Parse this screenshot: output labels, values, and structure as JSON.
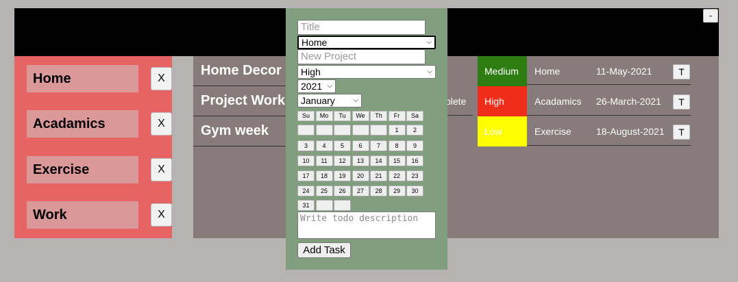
{
  "header": {
    "minimize_label": "-"
  },
  "sidebar": {
    "categories": [
      {
        "label": "Home",
        "remove_label": "X"
      },
      {
        "label": "Acadamics",
        "remove_label": "X"
      },
      {
        "label": "Exercise",
        "remove_label": "X"
      },
      {
        "label": "Work",
        "remove_label": "X"
      }
    ]
  },
  "tasks": [
    {
      "title": "Home Decor",
      "status": "",
      "priority": "Medium",
      "priority_color": "#2d7d12",
      "category": "Home",
      "date": "11-May-2021",
      "action_label": "T"
    },
    {
      "title": "Project Work",
      "status": "plete",
      "priority": "High",
      "priority_color": "#ef2d1a",
      "category": "Acadamics",
      "date": "26-March-2021",
      "action_label": "T"
    },
    {
      "title": "Gym week",
      "status": "",
      "priority": "Low",
      "priority_color": "#fdff00",
      "category": "Exercise",
      "date": "18-August-2021",
      "action_label": "T"
    }
  ],
  "form": {
    "title_placeholder": "Title",
    "category_value": "Home",
    "project_placeholder": "New Project",
    "priority_value": "High",
    "year_value": "2021",
    "month_value": "January",
    "weekdays": [
      "Su",
      "Mo",
      "Tu",
      "We",
      "Th",
      "Fr",
      "Sa"
    ],
    "days": [
      "1",
      "2",
      "3",
      "4",
      "5",
      "6",
      "7",
      "8",
      "9",
      "10",
      "11",
      "12",
      "13",
      "14",
      "15",
      "16",
      "17",
      "18",
      "19",
      "20",
      "21",
      "22",
      "23",
      "24",
      "25",
      "26",
      "27",
      "28",
      "29",
      "30",
      "31"
    ],
    "description_placeholder": "Write todo description",
    "add_label": "Add Task"
  }
}
